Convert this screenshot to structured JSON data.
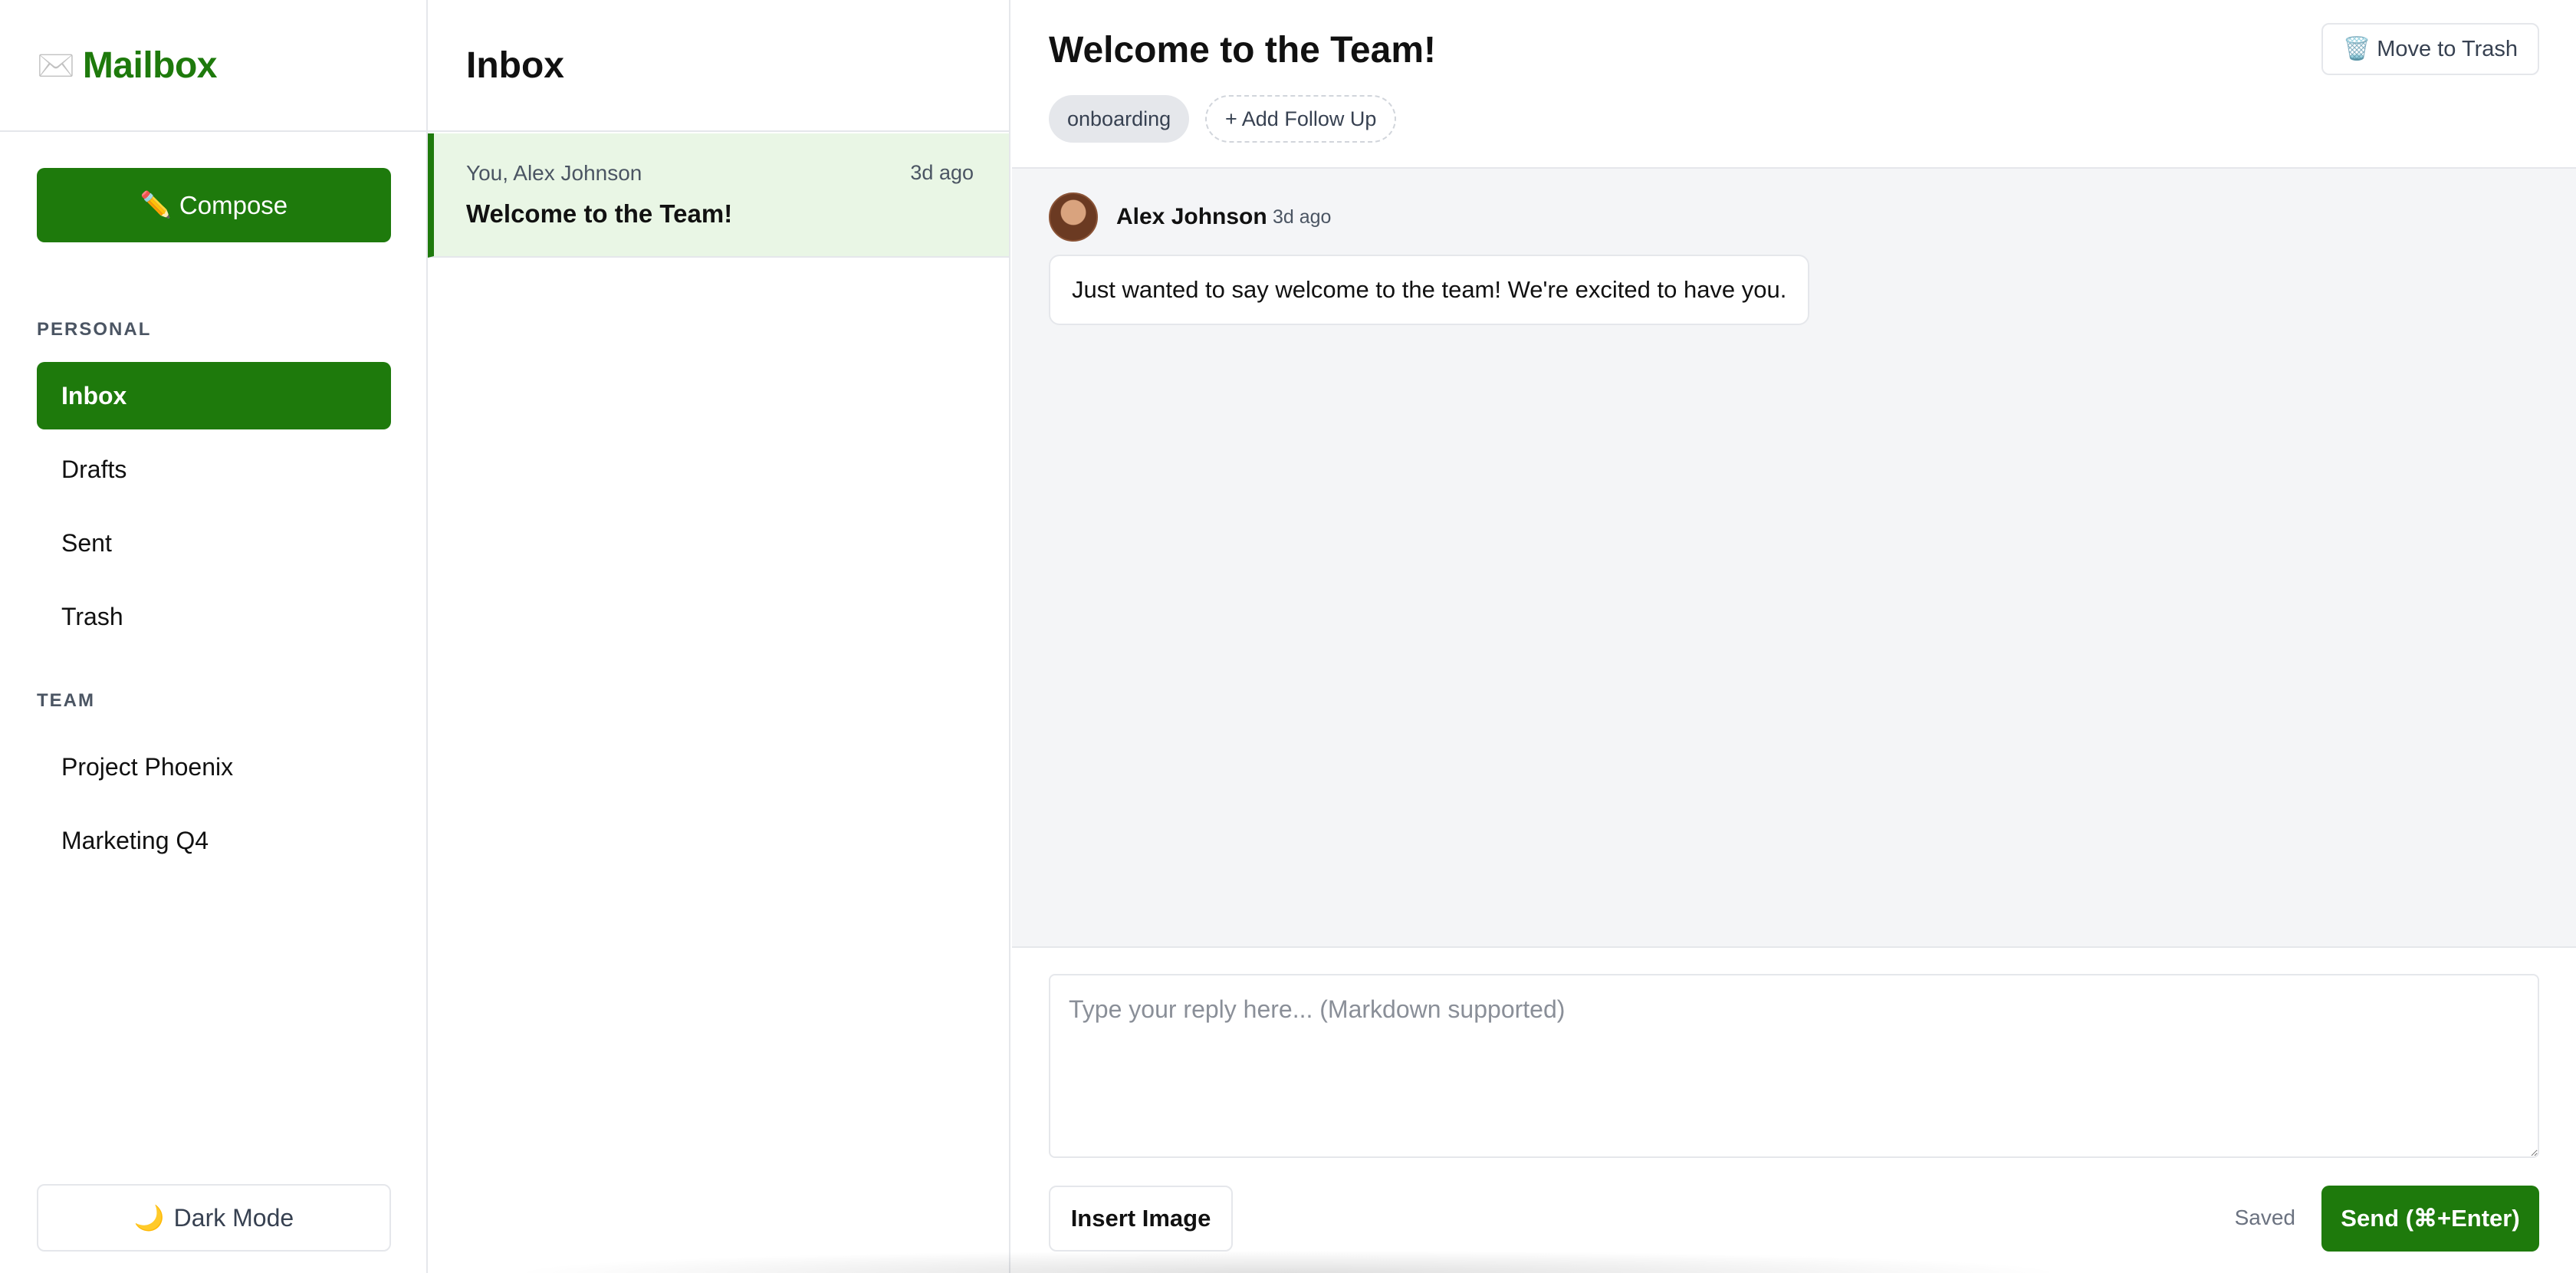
{
  "app": {
    "brand_icon": "envelope-icon",
    "brand_name": "Mailbox",
    "accent_color": "#1e7a0c"
  },
  "sidebar": {
    "compose_icon": "pencil-icon",
    "compose_label": "Compose",
    "sections": [
      {
        "label": "PERSONAL",
        "items": [
          {
            "label": "Inbox",
            "active": true
          },
          {
            "label": "Drafts",
            "active": false
          },
          {
            "label": "Sent",
            "active": false
          },
          {
            "label": "Trash",
            "active": false
          }
        ]
      },
      {
        "label": "TEAM",
        "items": [
          {
            "label": "Project Phoenix",
            "active": false
          },
          {
            "label": "Marketing Q4",
            "active": false
          }
        ]
      }
    ],
    "dark_mode_icon": "moon-icon",
    "dark_mode_label": "Dark Mode"
  },
  "list": {
    "title": "Inbox",
    "threads": [
      {
        "from": "You, Alex Johnson",
        "time": "3d ago",
        "subject": "Welcome to the Team!",
        "selected": true
      }
    ]
  },
  "detail": {
    "title": "Welcome to the Team!",
    "trash_icon": "trash-icon",
    "trash_label": "Move to Trash",
    "tags": [
      "onboarding"
    ],
    "add_followup_label": "+ Add Follow Up",
    "messages": [
      {
        "sender": "Alex Johnson",
        "time": "3d ago",
        "body": "Just wanted to say welcome to the team! We're excited to have you."
      }
    ]
  },
  "reply": {
    "placeholder": "Type your reply here... (Markdown supported)",
    "value": "",
    "insert_image_label": "Insert Image",
    "status": "Saved",
    "send_label": "Send (⌘+Enter)"
  }
}
